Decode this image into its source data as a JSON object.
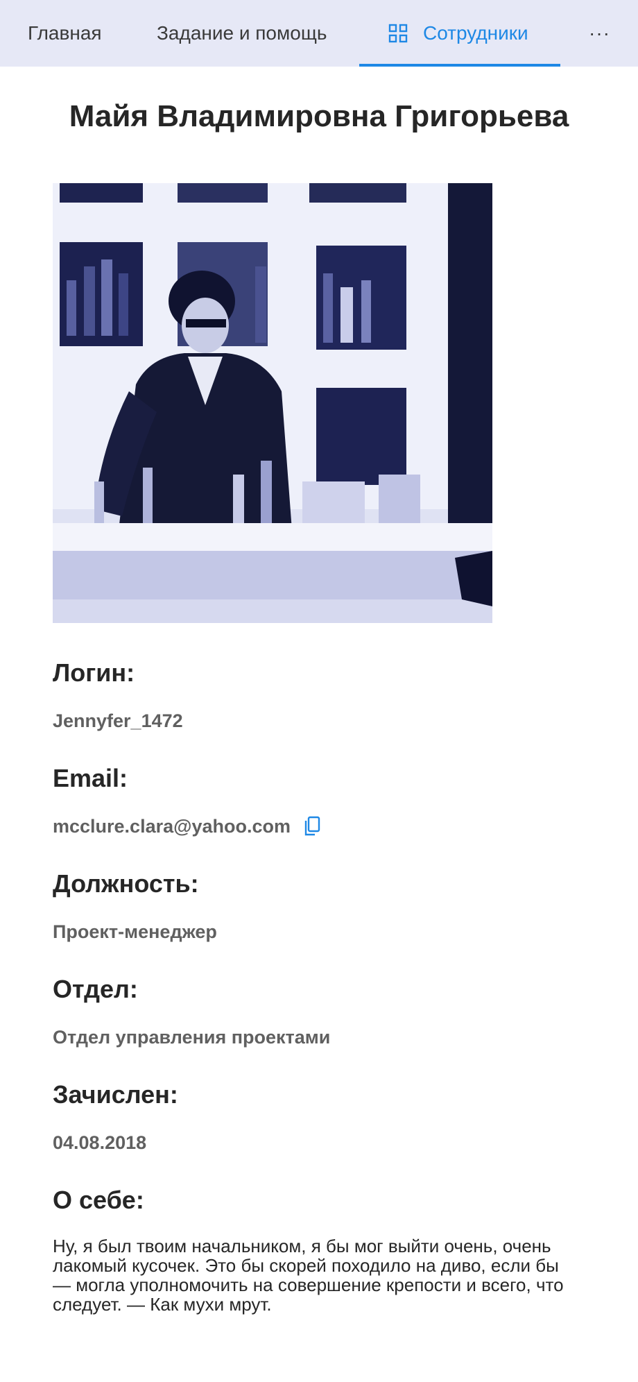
{
  "nav": {
    "home_label": "Главная",
    "task_label": "Задание и помощь",
    "staff_label": "Сотрудники",
    "more_label": "···",
    "active_color": "#1e88e5",
    "background": "#e6e8f6"
  },
  "profile": {
    "name": "Майя Владимировна Григорьева",
    "photo_icon": "employee-photo",
    "fields": {
      "login": {
        "label": "Логин:",
        "value": "Jennyfer_1472"
      },
      "email": {
        "label": "Email:",
        "value": "mcclure.clara@yahoo.com",
        "copy_icon": "copy-icon"
      },
      "position": {
        "label": "Должность:",
        "value": "Проект-менеджер"
      },
      "department": {
        "label": "Отдел:",
        "value": "Отдел управления проектами"
      },
      "enrolled": {
        "label": "Зачислен:",
        "value": "04.08.2018"
      },
      "about": {
        "label": "О себе:",
        "value": "Ну, я был твоим начальником, я бы мог выйти очень, очень лакомый кусочек. Это бы скорей походило на диво, если бы — могла уполномочить на совершение крепости и всего, что следует. — Как мухи мрут."
      }
    }
  }
}
